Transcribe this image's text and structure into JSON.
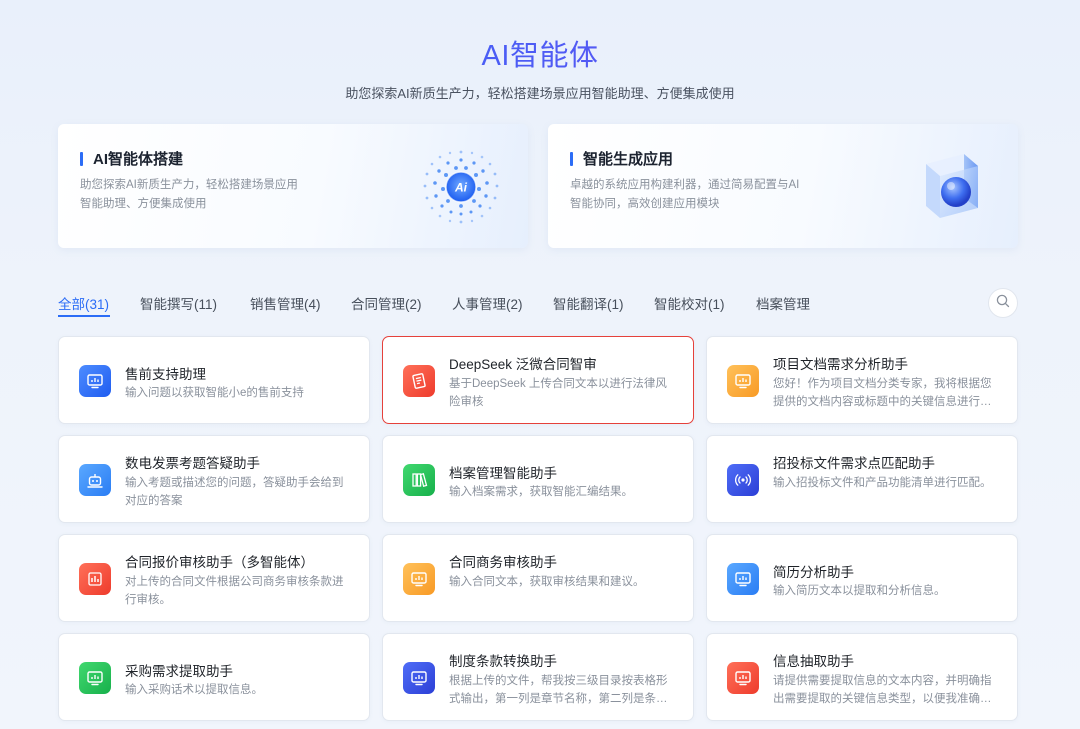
{
  "header": {
    "title": "AI智能体",
    "subtitle": "助您探索AI新质生产力，轻松搭建场景应用智能助理、方便集成使用"
  },
  "banners": [
    {
      "title": "AI智能体搭建",
      "desc": "助您探索AI新质生产力，轻松搭建场景应用 智能助理、方便集成使用",
      "art_text": "Ai"
    },
    {
      "title": "智能生成应用",
      "desc": "卓越的系统应用构建利器，通过简易配置与AI智能协同，高效创建应用模块"
    }
  ],
  "tabs": [
    {
      "label": "全部(31)",
      "active": true
    },
    {
      "label": "智能撰写(11)"
    },
    {
      "label": "销售管理(4)"
    },
    {
      "label": "合同管理(2)"
    },
    {
      "label": "人事管理(2)"
    },
    {
      "label": "智能翻译(1)"
    },
    {
      "label": "智能校对(1)"
    },
    {
      "label": "档案管理"
    }
  ],
  "cards": [
    {
      "title": "售前支持助理",
      "desc": "输入问题以获取智能小e的售前支持",
      "icon": "monitor-chart-icon",
      "color": "blue"
    },
    {
      "title": "DeepSeek 泛微合同智审",
      "desc": "基于DeepSeek 上传合同文本以进行法律风险审核",
      "icon": "contract-icon",
      "color": "red",
      "selected": true
    },
    {
      "title": "项目文档需求分析助手",
      "desc": "您好！作为项目文档分类专家，我将根据您提供的文档内容或标题中的关键信息进行分类",
      "icon": "monitor-chart-icon",
      "color": "orange"
    },
    {
      "title": "数电发票考题答疑助手",
      "desc": "输入考题或描述您的问题，答疑助手会给到对应的答案",
      "icon": "robot-icon",
      "color": "sky"
    },
    {
      "title": "档案管理智能助手",
      "desc": "输入档案需求，获取智能汇编结果。",
      "icon": "archive-icon",
      "color": "green"
    },
    {
      "title": "招投标文件需求点匹配助手",
      "desc": "输入招投标文件和产品功能清单进行匹配。",
      "icon": "broadcast-icon",
      "color": "indigo"
    },
    {
      "title": "合同报价审核助手（多智能体）",
      "desc": "对上传的合同文件根据公司商务审核条款进行审核。",
      "icon": "bar-chart-icon",
      "color": "red"
    },
    {
      "title": "合同商务审核助手",
      "desc": "输入合同文本，获取审核结果和建议。",
      "icon": "monitor-chart-icon",
      "color": "orange"
    },
    {
      "title": "简历分析助手",
      "desc": "输入简历文本以提取和分析信息。",
      "icon": "monitor-chart-icon",
      "color": "sky"
    },
    {
      "title": "采购需求提取助手",
      "desc": "输入采购话术以提取信息。",
      "icon": "monitor-chart-icon",
      "color": "green"
    },
    {
      "title": "制度条款转换助手",
      "desc": "根据上传的文件，帮我按三级目录按表格形式输出，第一列是章节名称，第二列是条款内容",
      "icon": "monitor-chart-icon",
      "color": "indigo"
    },
    {
      "title": "信息抽取助手",
      "desc": "请提供需要提取信息的文本内容，并明确指出需要提取的关键信息类型，以便我准确抽取",
      "icon": "monitor-chart-icon",
      "color": "red"
    }
  ],
  "colors": {
    "accent": "#2b6cf6",
    "selected_border": "#e5413b"
  }
}
